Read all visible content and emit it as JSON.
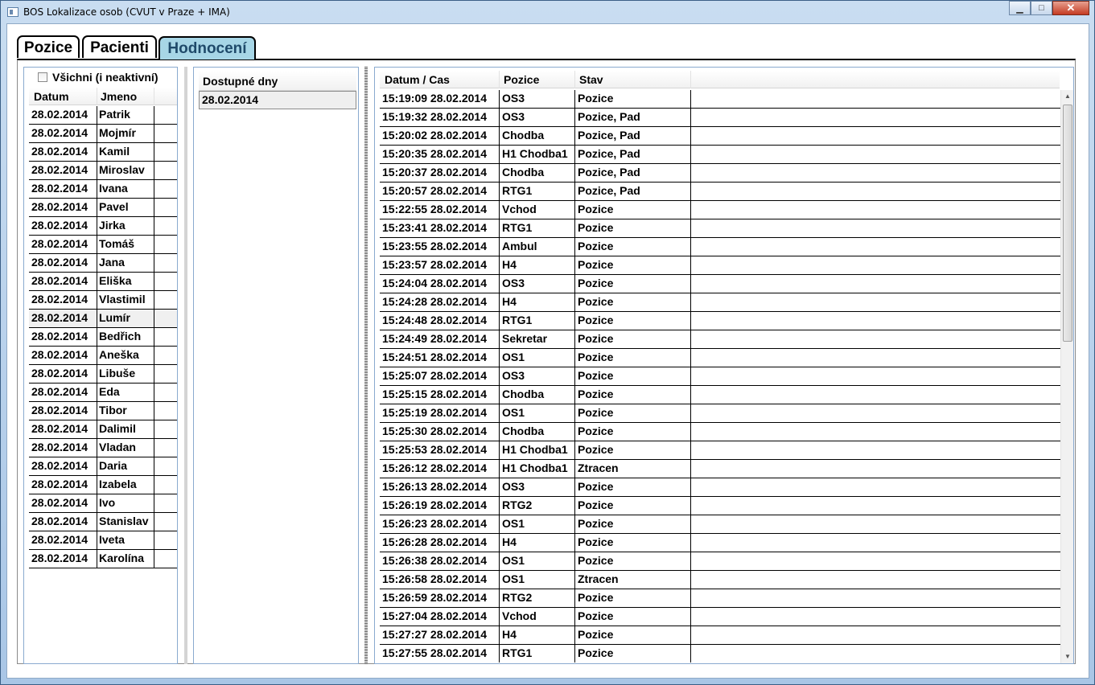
{
  "window": {
    "title": "BOS Lokalizace osob (CVUT v Praze + IMA)"
  },
  "tabs": [
    {
      "label": "Pozice"
    },
    {
      "label": "Pacienti"
    },
    {
      "label": "Hodnocení"
    }
  ],
  "left_panel": {
    "checkbox_label": "Všichni (i neaktivní)",
    "checkbox_checked": false,
    "columns": [
      "Datum",
      "Jmeno"
    ],
    "rows": [
      [
        "28.02.2014",
        "Patrik"
      ],
      [
        "28.02.2014",
        "Mojmír"
      ],
      [
        "28.02.2014",
        "Kamil"
      ],
      [
        "28.02.2014",
        "Miroslav"
      ],
      [
        "28.02.2014",
        "Ivana"
      ],
      [
        "28.02.2014",
        "Pavel"
      ],
      [
        "28.02.2014",
        "Jirka"
      ],
      [
        "28.02.2014",
        "Tomáš"
      ],
      [
        "28.02.2014",
        "Jana"
      ],
      [
        "28.02.2014",
        "Eliška"
      ],
      [
        "28.02.2014",
        "Vlastimil"
      ],
      [
        "28.02.2014",
        "Lumír"
      ],
      [
        "28.02.2014",
        "Bedřich"
      ],
      [
        "28.02.2014",
        "Aneška"
      ],
      [
        "28.02.2014",
        "Libuše"
      ],
      [
        "28.02.2014",
        "Eda"
      ],
      [
        "28.02.2014",
        "Tibor"
      ],
      [
        "28.02.2014",
        "Dalimil"
      ],
      [
        "28.02.2014",
        "Vladan"
      ],
      [
        "28.02.2014",
        "Daria"
      ],
      [
        "28.02.2014",
        "Izabela"
      ],
      [
        "28.02.2014",
        "Ivo"
      ],
      [
        "28.02.2014",
        "Stanislav"
      ],
      [
        "28.02.2014",
        "Iveta"
      ],
      [
        "28.02.2014",
        "Karolína"
      ]
    ],
    "highlighted_row": 11
  },
  "middle_panel": {
    "header": "Dostupné dny",
    "rows": [
      "28.02.2014"
    ]
  },
  "right_panel": {
    "columns": [
      "Datum / Cas",
      "Pozice",
      "Stav"
    ],
    "rows": [
      [
        "15:19:09 28.02.2014",
        "OS3",
        "Pozice"
      ],
      [
        "15:19:32 28.02.2014",
        "OS3",
        "Pozice, Pad"
      ],
      [
        "15:20:02 28.02.2014",
        "Chodba",
        "Pozice, Pad"
      ],
      [
        "15:20:35 28.02.2014",
        "H1 Chodba1",
        "Pozice, Pad"
      ],
      [
        "15:20:37 28.02.2014",
        "Chodba",
        "Pozice, Pad"
      ],
      [
        "15:20:57 28.02.2014",
        "RTG1",
        "Pozice, Pad"
      ],
      [
        "15:22:55 28.02.2014",
        "Vchod",
        "Pozice"
      ],
      [
        "15:23:41 28.02.2014",
        "RTG1",
        "Pozice"
      ],
      [
        "15:23:55 28.02.2014",
        "Ambul",
        "Pozice"
      ],
      [
        "15:23:57 28.02.2014",
        "H4",
        "Pozice"
      ],
      [
        "15:24:04 28.02.2014",
        "OS3",
        "Pozice"
      ],
      [
        "15:24:28 28.02.2014",
        "H4",
        "Pozice"
      ],
      [
        "15:24:48 28.02.2014",
        "RTG1",
        "Pozice"
      ],
      [
        "15:24:49 28.02.2014",
        "Sekretar",
        "Pozice"
      ],
      [
        "15:24:51 28.02.2014",
        "OS1",
        "Pozice"
      ],
      [
        "15:25:07 28.02.2014",
        "OS3",
        "Pozice"
      ],
      [
        "15:25:15 28.02.2014",
        "Chodba",
        "Pozice"
      ],
      [
        "15:25:19 28.02.2014",
        "OS1",
        "Pozice"
      ],
      [
        "15:25:30 28.02.2014",
        "Chodba",
        "Pozice"
      ],
      [
        "15:25:53 28.02.2014",
        "H1 Chodba1",
        "Pozice"
      ],
      [
        "15:26:12 28.02.2014",
        "H1 Chodba1",
        "Ztracen"
      ],
      [
        "15:26:13 28.02.2014",
        "OS3",
        "Pozice"
      ],
      [
        "15:26:19 28.02.2014",
        "RTG2",
        "Pozice"
      ],
      [
        "15:26:23 28.02.2014",
        "OS1",
        "Pozice"
      ],
      [
        "15:26:28 28.02.2014",
        "H4",
        "Pozice"
      ],
      [
        "15:26:38 28.02.2014",
        "OS1",
        "Pozice"
      ],
      [
        "15:26:58 28.02.2014",
        "OS1",
        "Ztracen"
      ],
      [
        "15:26:59 28.02.2014",
        "RTG2",
        "Pozice"
      ],
      [
        "15:27:04 28.02.2014",
        "Vchod",
        "Pozice"
      ],
      [
        "15:27:27 28.02.2014",
        "H4",
        "Pozice"
      ],
      [
        "15:27:55 28.02.2014",
        "RTG1",
        "Pozice"
      ]
    ]
  },
  "colors": {
    "active_tab": "#a7d6e6",
    "window_frame": "#a9c6e6"
  }
}
